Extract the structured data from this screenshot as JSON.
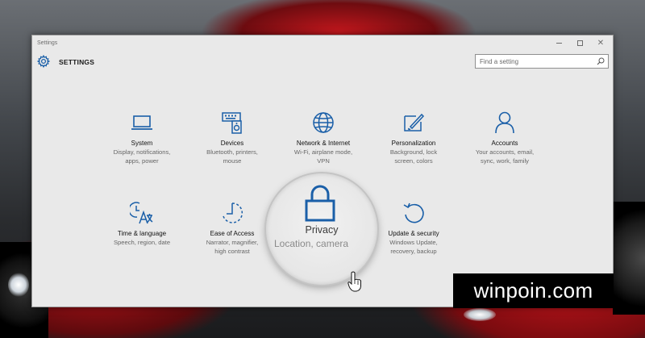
{
  "window": {
    "title": "Settings",
    "controls": {
      "minimize": "minimize",
      "maximize": "maximize",
      "close": "✕"
    }
  },
  "header": {
    "title": "SETTINGS",
    "search_placeholder": "Find a setting"
  },
  "categories": [
    {
      "name": "System",
      "desc": [
        "Display, notifications,",
        "apps, power"
      ],
      "icon": "laptop-icon"
    },
    {
      "name": "Devices",
      "desc": [
        "Bluetooth, printers,",
        "mouse"
      ],
      "icon": "devices-icon"
    },
    {
      "name": "Network & Internet",
      "desc": [
        "Wi-Fi, airplane mode,",
        "VPN"
      ],
      "icon": "globe-icon"
    },
    {
      "name": "Personalization",
      "desc": [
        "Background, lock",
        "screen, colors"
      ],
      "icon": "paint-icon"
    },
    {
      "name": "Accounts",
      "desc": [
        "Your accounts, email,",
        "sync, work, family"
      ],
      "icon": "person-icon"
    },
    {
      "name": "Time & language",
      "desc": [
        "Speech, region, date"
      ],
      "icon": "clock-language-icon"
    },
    {
      "name": "Ease of Access",
      "desc": [
        "Narrator, magnifier,",
        "high contrast"
      ],
      "icon": "ease-of-access-icon"
    },
    {
      "name": "Privacy",
      "desc": [
        "Location, camera"
      ],
      "icon": "lock-icon"
    },
    {
      "name": "Update & security",
      "desc": [
        "Windows Update,",
        "recovery, backup"
      ],
      "icon": "refresh-icon"
    }
  ],
  "watermark": "winpoin.com",
  "colors": {
    "accent": "#1a5fa8",
    "window_bg": "#e9e9e9"
  }
}
